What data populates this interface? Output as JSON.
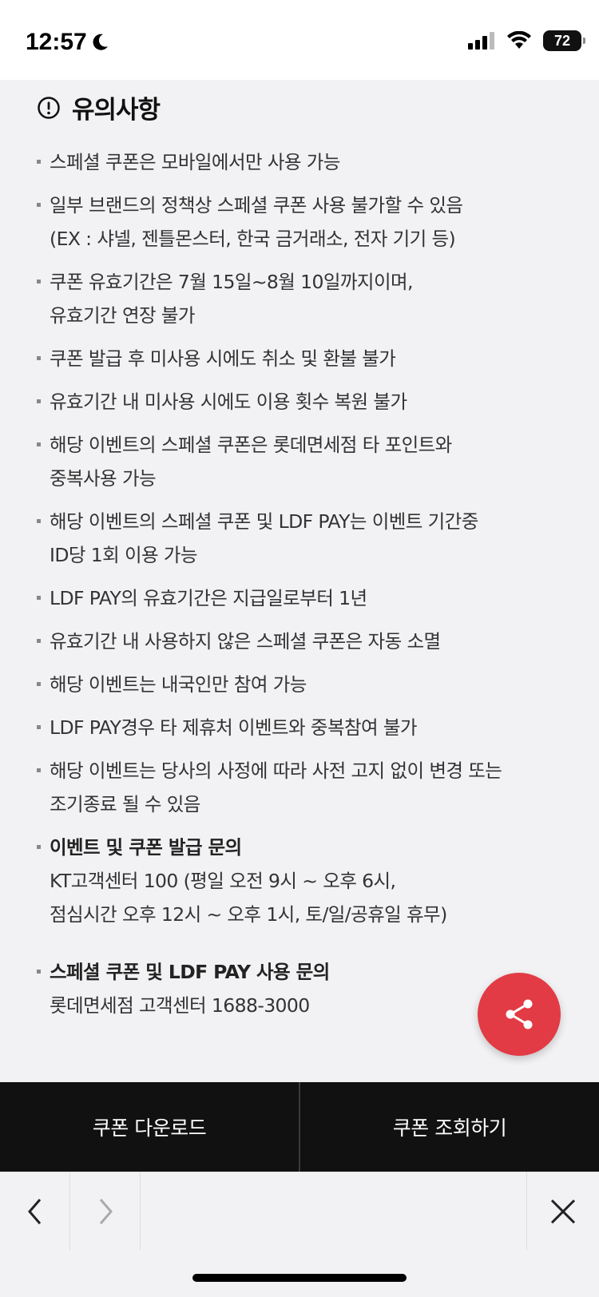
{
  "status_bar": {
    "time": "12:57",
    "battery": "72"
  },
  "notice": {
    "title": "유의사항",
    "items": [
      {
        "lines": [
          "스페셜 쿠폰은 모바일에서만 사용 가능"
        ]
      },
      {
        "lines": [
          "일부 브랜드의 정책상 스페셜 쿠폰 사용 불가할 수 있음",
          "(EX : 샤넬, 젠틀몬스터, 한국 금거래소, 전자 기기 등)"
        ]
      },
      {
        "lines": [
          "쿠폰 유효기간은 7월 15일~8월 10일까지이며,",
          "유효기간 연장 불가"
        ]
      },
      {
        "lines": [
          "쿠폰 발급 후 미사용 시에도 취소 및 환불 불가"
        ]
      },
      {
        "lines": [
          "유효기간 내 미사용 시에도 이용 횟수 복원 불가"
        ]
      },
      {
        "lines": [
          "해당 이벤트의 스페셜 쿠폰은 롯데면세점 타 포인트와",
          "중복사용 가능"
        ]
      },
      {
        "lines": [
          "해당 이벤트의 스페셜 쿠폰 및 LDF PAY는 이벤트 기간중",
          "ID당 1회 이용 가능"
        ]
      },
      {
        "lines": [
          "LDF PAY의 유효기간은 지급일로부터 1년"
        ]
      },
      {
        "lines": [
          "유효기간 내 사용하지 않은 스페셜 쿠폰은 자동 소멸"
        ]
      },
      {
        "lines": [
          "해당 이벤트는 내국인만 참여 가능"
        ]
      },
      {
        "lines": [
          "LDF PAY경우 타 제휴처 이벤트와 중복참여 불가"
        ]
      },
      {
        "lines": [
          "해당 이벤트는 당사의 사정에 따라 사전 고지 없이 변경 또는",
          "조기종료 될 수 있음"
        ]
      }
    ],
    "contacts": [
      {
        "lines": [
          "이벤트 및 쿠폰 발급 문의",
          "KT고객센터 100 (평일 오전 9시 ~ 오후 6시,",
          "점심시간 오후 12시 ~ 오후 1시, 토/일/공휴일 휴무)"
        ]
      },
      {
        "lines": [
          "스페셜 쿠폰 및 LDF PAY 사용 문의",
          "롯데면세점 고객센터 1688-3000"
        ]
      }
    ]
  },
  "fab": {
    "icon": "share-icon",
    "color": "#e23b45"
  },
  "bottom_bar": {
    "download_label": "쿠폰 다운로드",
    "lookup_label": "쿠폰 조회하기"
  },
  "browser_nav": {
    "back_icon": "chevron-left-icon",
    "forward_icon": "chevron-right-icon",
    "close_icon": "close-icon"
  }
}
